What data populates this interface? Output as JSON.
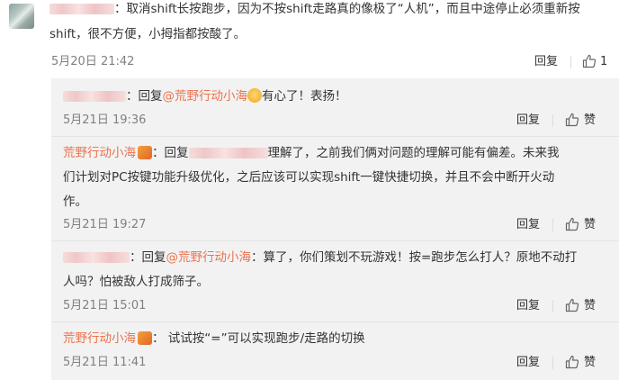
{
  "comment": {
    "line1": "：取消shift长按跑步，因为不按shift走路真的像极了“人机”，而且中途停止必须重新按",
    "line2": "shift，很不方便，小拇指都按酸了。",
    "time": "5月20日 21:42",
    "reply_label": "回复",
    "like_count": "1"
  },
  "replies": [
    {
      "prefix": "：回复",
      "mention": "@荒野行动小海",
      "text": "有心了！表扬！",
      "time": "5月21日 19:36",
      "reply_label": "回复",
      "like_label": "赞"
    },
    {
      "author": "荒野行动小海",
      "prefix": "：回复",
      "text_line1": "理解了，之前我们俩对问题的理解可能有偏差。未来我",
      "text_line2": "们计划对PC按键功能升级优化，之后应该可以实现shift一键快捷切换，并且不会中断开火动",
      "text_line3": "作。",
      "time": "5月21日 19:27",
      "reply_label": "回复",
      "like_label": "赞"
    },
    {
      "prefix": "：回复",
      "mention": "@荒野行动小海",
      "text_line1": "：算了，你们策划不玩游戏！按=跑步怎么打人？原地不动打",
      "text_line2": "人吗？怕被敌人打成筛子。",
      "time": "5月21日 15:01",
      "reply_label": "回复",
      "like_label": "赞"
    },
    {
      "author": "荒野行动小海",
      "text": "：  试试按“=”可以实现跑步/走路的切换",
      "time": "5月21日 11:41",
      "reply_label": "回复",
      "like_label": "赞"
    }
  ],
  "colors": {
    "link": "#eb7350",
    "meta": "#808080",
    "reply_bg": "#f2f2f2"
  },
  "icons": {
    "like": "thumbs-up-icon",
    "emoji": "pleading-face-icon",
    "badge": "verified-badge-icon"
  }
}
